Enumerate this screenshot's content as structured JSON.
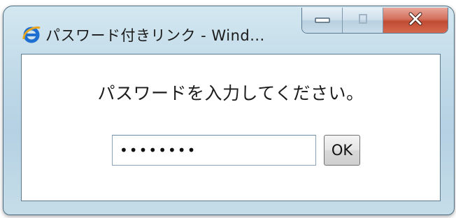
{
  "window": {
    "title": "パスワード付きリンク - Wind...",
    "icon": "internet-explorer-icon"
  },
  "caption_buttons": {
    "minimize_icon": "minimize-icon",
    "maximize_icon": "maximize-icon",
    "close_icon": "close-icon"
  },
  "dialog": {
    "prompt": "パスワードを入力してください。",
    "password_value": "********",
    "ok_label": "OK"
  },
  "colors": {
    "frame": "#bfd9e8",
    "close_button": "#c04a33",
    "ie_blue": "#1f6fd1"
  }
}
